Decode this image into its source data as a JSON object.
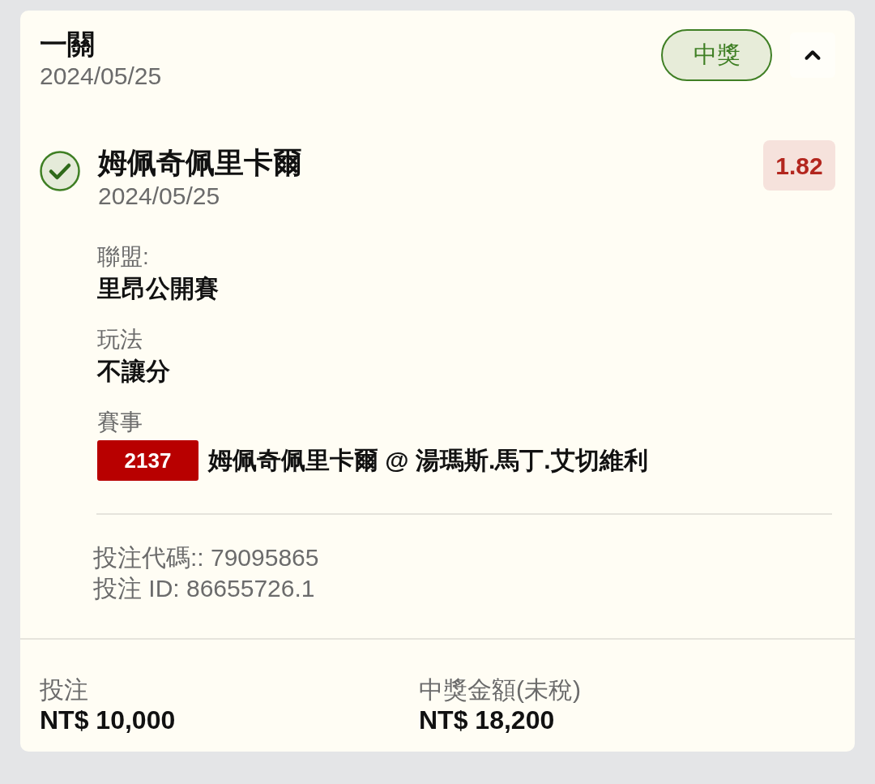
{
  "bet": {
    "title": "一關",
    "date": "2024/05/25",
    "status": {
      "label": "中獎",
      "kind": "won"
    },
    "expanded": true
  },
  "selections": [
    {
      "name": "姆佩奇佩里卡爾",
      "date": "2024/05/25",
      "odds": "1.82",
      "won": true,
      "details": [
        {
          "kind": "text",
          "label": "聯盟:",
          "value": "里昂公開賽"
        },
        {
          "kind": "text",
          "label": "玩法",
          "value": "不讓分"
        },
        {
          "kind": "event",
          "label": "賽事",
          "code": "2137",
          "value": "姆佩奇佩里卡爾 @ 湯瑪斯.馬丁.艾切維利"
        }
      ]
    }
  ],
  "references": [
    "投注代碼:: 79095865",
    "投注 ID: 86655726.1"
  ],
  "summary": [
    {
      "label": "投注",
      "value": "NT$ 10,000"
    },
    {
      "label": "中獎金額(未稅)",
      "value": "NT$ 18,200"
    }
  ]
}
